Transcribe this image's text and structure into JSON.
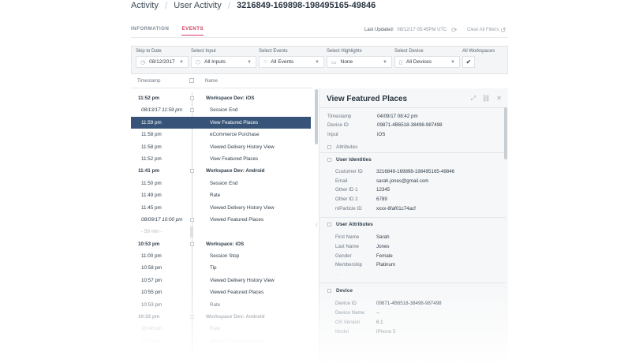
{
  "breadcrumb": {
    "root": "Activity",
    "section": "User Activity",
    "current": "3216849-169898-198495165-49846"
  },
  "tabs": [
    {
      "label": "INFORMATION"
    },
    {
      "label": "EVENTS"
    }
  ],
  "header": {
    "last_updated_label": "Last Updated:",
    "last_updated_value": "08/12/17   05:45PM UTC",
    "clear_filters": "Clear All Filters"
  },
  "filters": {
    "skip_to_date": {
      "label": "Skip to Date",
      "value": "08/12/2017"
    },
    "select_input": {
      "label": "Select Input",
      "value": "All Inputs"
    },
    "select_events": {
      "label": "Select Events",
      "value": "All Events"
    },
    "select_highlights": {
      "label": "Select Highlights",
      "value": "None"
    },
    "select_device": {
      "label": "Select Device",
      "value": "All Devices"
    },
    "all_workspaces": {
      "label": "All Workspaces",
      "checked": true
    }
  },
  "columns": {
    "timestamp": "Timestamp",
    "name": "Name"
  },
  "rows": [
    {
      "time": "11:52 pm",
      "name": "Workspace Dev: iOS",
      "kind": "group"
    },
    {
      "time": "08/13/17 11:59 pm",
      "name": "Session End",
      "kind": "italic"
    },
    {
      "time": "11:59 pm",
      "name": "View Featured Places",
      "kind": "selected"
    },
    {
      "time": "11:58 pm",
      "name": "eCommerce Purchase",
      "kind": "event"
    },
    {
      "time": "11:58 pm",
      "name": "Viewed Delivery History View",
      "kind": "event"
    },
    {
      "time": "11:52 pm",
      "name": "View Featured Places",
      "kind": "event"
    },
    {
      "time": "11:41 pm",
      "name": "Workspace Dev: Android",
      "kind": "group"
    },
    {
      "time": "11:50 pm",
      "name": "Session End",
      "kind": "event"
    },
    {
      "time": "11:49 pm",
      "name": "Rate",
      "kind": "event"
    },
    {
      "time": "11:45 pm",
      "name": "Viewed Delivery History View",
      "kind": "event"
    },
    {
      "time": "08/09/17 10:00 pm",
      "name": "Viewed Featured Places",
      "kind": "italic"
    },
    {
      "time": "- 59 min -",
      "name": "",
      "kind": "gap"
    },
    {
      "time": "10:53 pm",
      "name": "Workspace: iOS",
      "kind": "group"
    },
    {
      "time": "11:00 pm",
      "name": "Session Stop",
      "kind": "event"
    },
    {
      "time": "10:58 pm",
      "name": "Tip",
      "kind": "event"
    },
    {
      "time": "10:57 pm",
      "name": "Viewed Delivery History View",
      "kind": "event"
    },
    {
      "time": "10:55 pm",
      "name": "Viewed Featured Places",
      "kind": "event"
    },
    {
      "time": "10:53 pm",
      "name": "Rate",
      "kind": "event"
    },
    {
      "time": "10:32 pm",
      "name": "Workspace Dev: Android",
      "kind": "group"
    },
    {
      "time": "10:40 pm",
      "name": "Rate",
      "kind": "event"
    },
    {
      "time": "10:35 pm",
      "name": "Viewed Featured Places",
      "kind": "event"
    }
  ],
  "detail": {
    "title": "View Featured Places",
    "summary": [
      {
        "k": "Timestamp",
        "v": "04/09/17  08:42 pm"
      },
      {
        "k": "Device ID",
        "v": "09871-4B6518-38498-987498"
      },
      {
        "k": "Input",
        "v": "iOS"
      }
    ],
    "attributes_label": "Attributes",
    "identities_label": "User Identities",
    "identities": [
      {
        "k": "Customer ID",
        "v": "3216849-169898-198495165-49846"
      },
      {
        "k": "Email",
        "v": "sarah.jones@gmail.com"
      },
      {
        "k": "Other ID 1",
        "v": "12345"
      },
      {
        "k": "Other ID 2",
        "v": "6789"
      },
      {
        "k": "mParticle ID",
        "v": "xxxx-8faf01c74acf"
      }
    ],
    "user_attributes_label": "User Attributes",
    "user_attributes": [
      {
        "k": "First Name",
        "v": "Sarah"
      },
      {
        "k": "Last Name",
        "v": "Jones"
      },
      {
        "k": "Gender",
        "v": "Female"
      },
      {
        "k": "Membership",
        "v": "Platinum"
      }
    ],
    "more": "...",
    "device_label": "Device",
    "device": [
      {
        "k": "Device ID",
        "v": "09871-4B6518-38498-987498"
      },
      {
        "k": "Device Name",
        "v": "--"
      },
      {
        "k": "OS Version",
        "v": "6.1"
      },
      {
        "k": "Model",
        "v": "iPhone 5"
      }
    ]
  }
}
